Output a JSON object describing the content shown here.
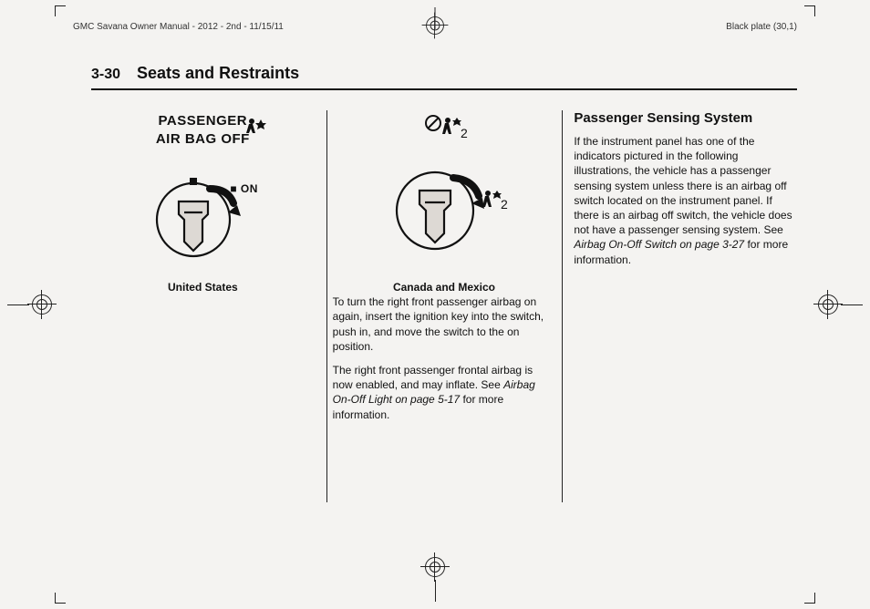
{
  "print_header": {
    "left": "GMC Savana Owner Manual - 2012 - 2nd - 11/15/11",
    "right": "Black plate (30,1)"
  },
  "page": {
    "number": "3-30",
    "section_title": "Seats and Restraints"
  },
  "col1": {
    "illus_text_line1": "PASSENGER",
    "illus_text_line2": "AIR BAG OFF",
    "illus_text_on": "ON",
    "caption": "United States"
  },
  "col2": {
    "caption": "Canada and Mexico",
    "p1": "To turn the right front passenger airbag on again, insert the ignition key into the switch, push in, and move the switch to the on position.",
    "p2_a": "The right front passenger frontal airbag is now enabled, and may inflate. See ",
    "p2_ref": "Airbag On-Off Light on page 5-17",
    "p2_b": " for more information."
  },
  "col3": {
    "heading": "Passenger Sensing System",
    "p1_a": "If the instrument panel has one of the indicators pictured in the following illustrations, the vehicle has a passenger sensing system unless there is an airbag off switch located on the instrument panel. If there is an airbag off switch, the vehicle does not have a passenger sensing system. See ",
    "p1_ref": "Airbag On-Off Switch on page 3-27",
    "p1_b": " for more information."
  }
}
